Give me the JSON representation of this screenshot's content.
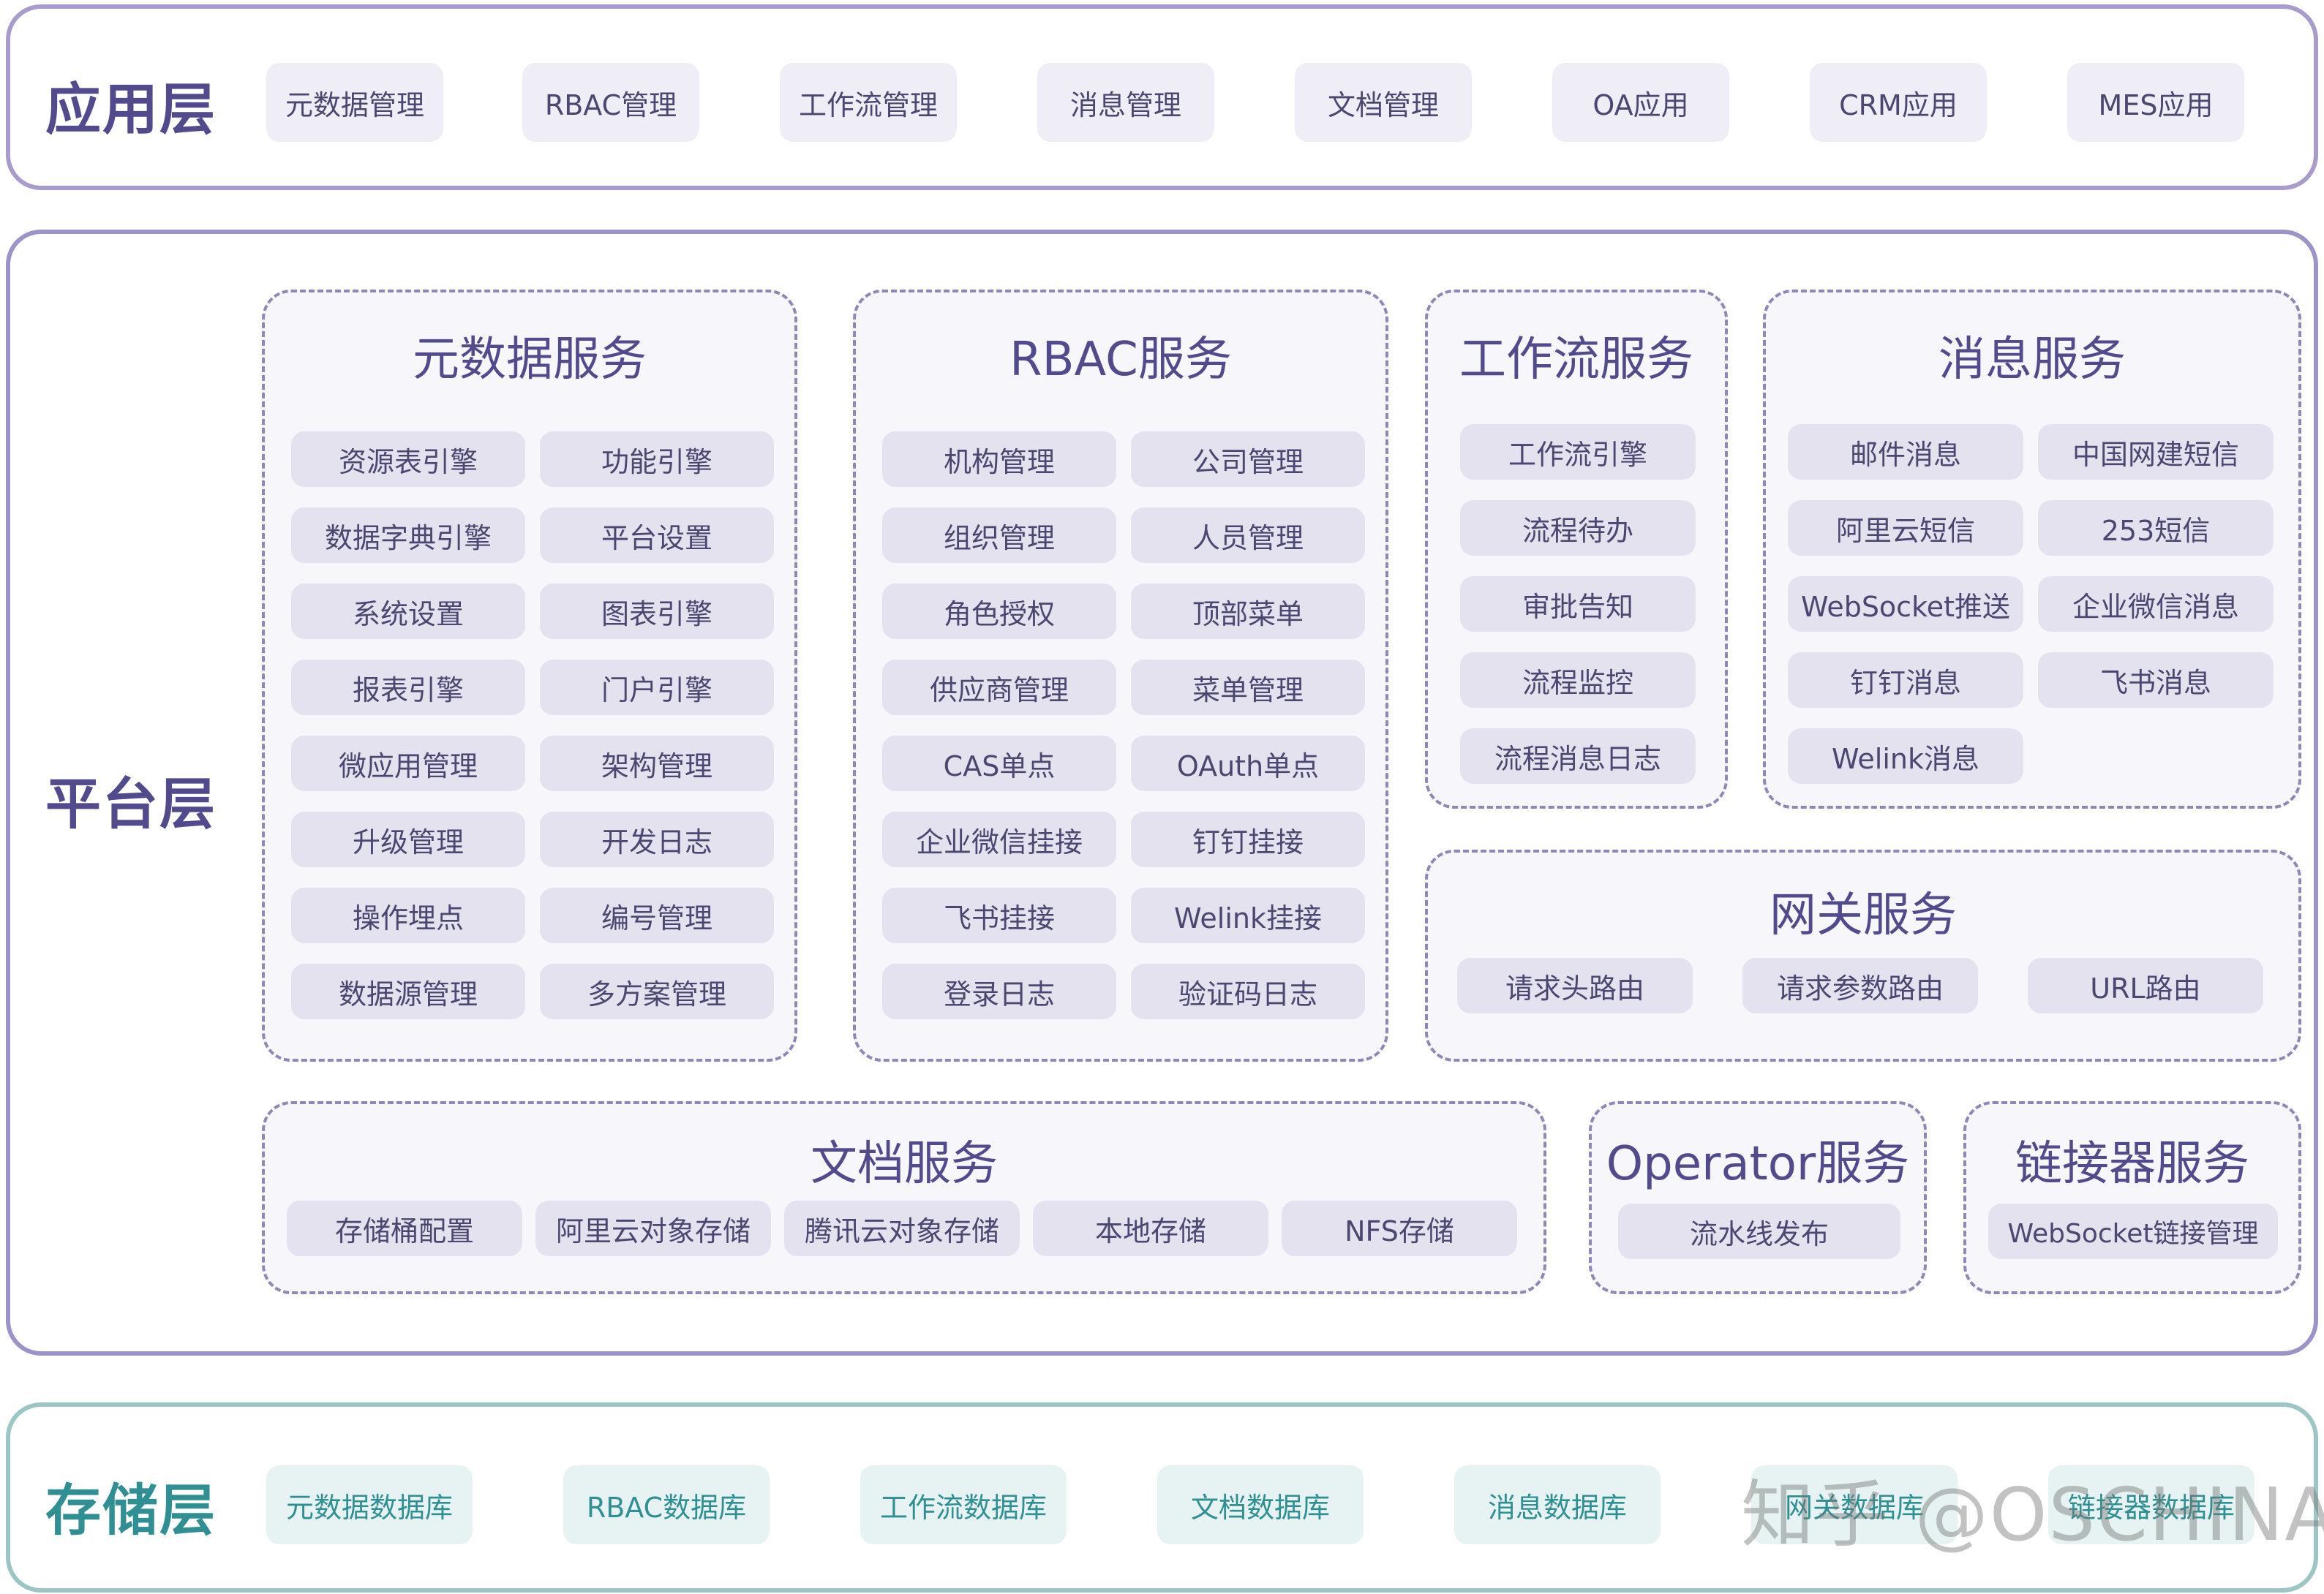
{
  "app_layer": {
    "title": "应用层",
    "items": [
      "元数据管理",
      "RBAC管理",
      "工作流管理",
      "消息管理",
      "文档管理",
      "OA应用",
      "CRM应用",
      "MES应用"
    ]
  },
  "platform_layer": {
    "title": "平台层",
    "metadata_service": {
      "title": "元数据服务",
      "items": [
        "资源表引擎",
        "功能引擎",
        "数据字典引擎",
        "平台设置",
        "系统设置",
        "图表引擎",
        "报表引擎",
        "门户引擎",
        "微应用管理",
        "架构管理",
        "升级管理",
        "开发日志",
        "操作埋点",
        "编号管理",
        "数据源管理",
        "多方案管理"
      ]
    },
    "rbac_service": {
      "title": "RBAC服务",
      "items": [
        "机构管理",
        "公司管理",
        "组织管理",
        "人员管理",
        "角色授权",
        "顶部菜单",
        "供应商管理",
        "菜单管理",
        "CAS单点",
        "OAuth单点",
        "企业微信挂接",
        "钉钉挂接",
        "飞书挂接",
        "Welink挂接",
        "登录日志",
        "验证码日志"
      ]
    },
    "workflow_service": {
      "title": "工作流服务",
      "items": [
        "工作流引擎",
        "流程待办",
        "审批告知",
        "流程监控",
        "流程消息日志"
      ]
    },
    "message_service": {
      "title": "消息服务",
      "items": [
        "邮件消息",
        "中国网建短信",
        "阿里云短信",
        "253短信",
        "WebSocket推送",
        "企业微信消息",
        "钉钉消息",
        "飞书消息",
        "Welink消息"
      ]
    },
    "gateway_service": {
      "title": "网关服务",
      "items": [
        "请求头路由",
        "请求参数路由",
        "URL路由"
      ]
    },
    "document_service": {
      "title": "文档服务",
      "items": [
        "存储桶配置",
        "阿里云对象存储",
        "腾讯云对象存储",
        "本地存储",
        "NFS存储"
      ]
    },
    "operator_service": {
      "title": "Operator服务",
      "items": [
        "流水线发布"
      ]
    },
    "connector_service": {
      "title": "链接器服务",
      "items": [
        "WebSocket链接管理"
      ]
    }
  },
  "storage_layer": {
    "title": "存储层",
    "items": [
      "元数据数据库",
      "RBAC数据库",
      "工作流数据库",
      "文档数据库",
      "消息数据库",
      "网关数据库",
      "链接器数据库"
    ]
  },
  "watermark": "知乎 @OSCHINA",
  "colors": {
    "app_border": "#a99bcc",
    "platform_border": "#9d93c9",
    "storage_border": "#9cc5c6",
    "title_purple": "#514a8c",
    "title_teal": "#2f8f92"
  }
}
